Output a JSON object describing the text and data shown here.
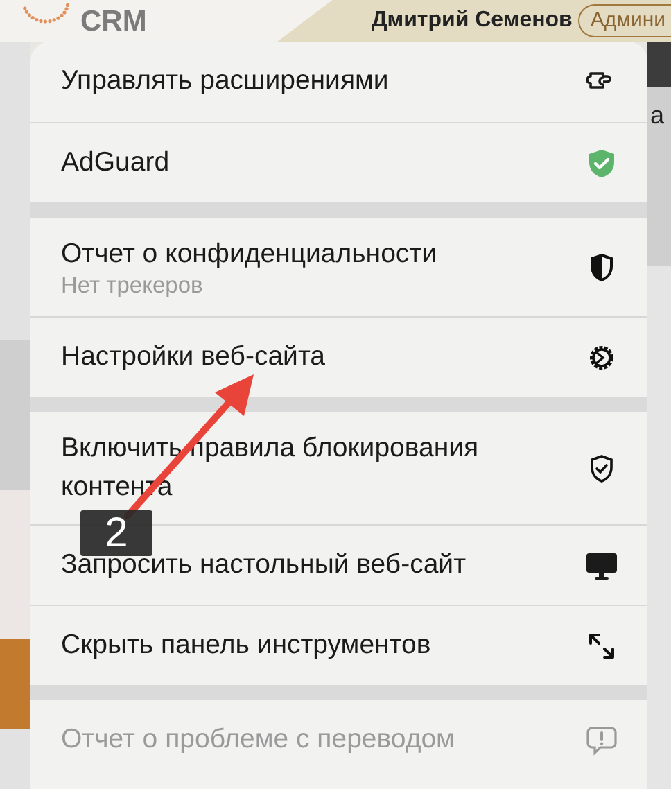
{
  "page_header": {
    "logo_text": "CRM",
    "user_name": "Дмитрий Семенов",
    "role_badge": "Админи"
  },
  "page_side_text": "а",
  "menu": {
    "groups": [
      {
        "items": [
          {
            "label": "Управлять расширениями",
            "kind": "puzzle",
            "disabled": false
          },
          {
            "label": "AdGuard",
            "kind": "adguard",
            "disabled": false
          }
        ]
      },
      {
        "items": [
          {
            "label": "Отчет о конфиденциальности",
            "sublabel": "Нет трекеров",
            "kind": "half-shield",
            "disabled": false
          },
          {
            "label": "Настройки веб-сайта",
            "kind": "gear",
            "disabled": false
          }
        ]
      },
      {
        "items": [
          {
            "label": "Включить правила блокирования контента",
            "kind": "shield-check",
            "disabled": false
          },
          {
            "label": "Запросить настольный веб-сайт",
            "kind": "monitor",
            "disabled": false
          },
          {
            "label": "Скрыть панель инструментов",
            "kind": "arrows",
            "disabled": false
          }
        ]
      },
      {
        "items": [
          {
            "label": "Отчет о проблеме с переводом",
            "kind": "alert-bubble",
            "disabled": true
          }
        ]
      }
    ]
  },
  "annotation": {
    "label": "2"
  }
}
